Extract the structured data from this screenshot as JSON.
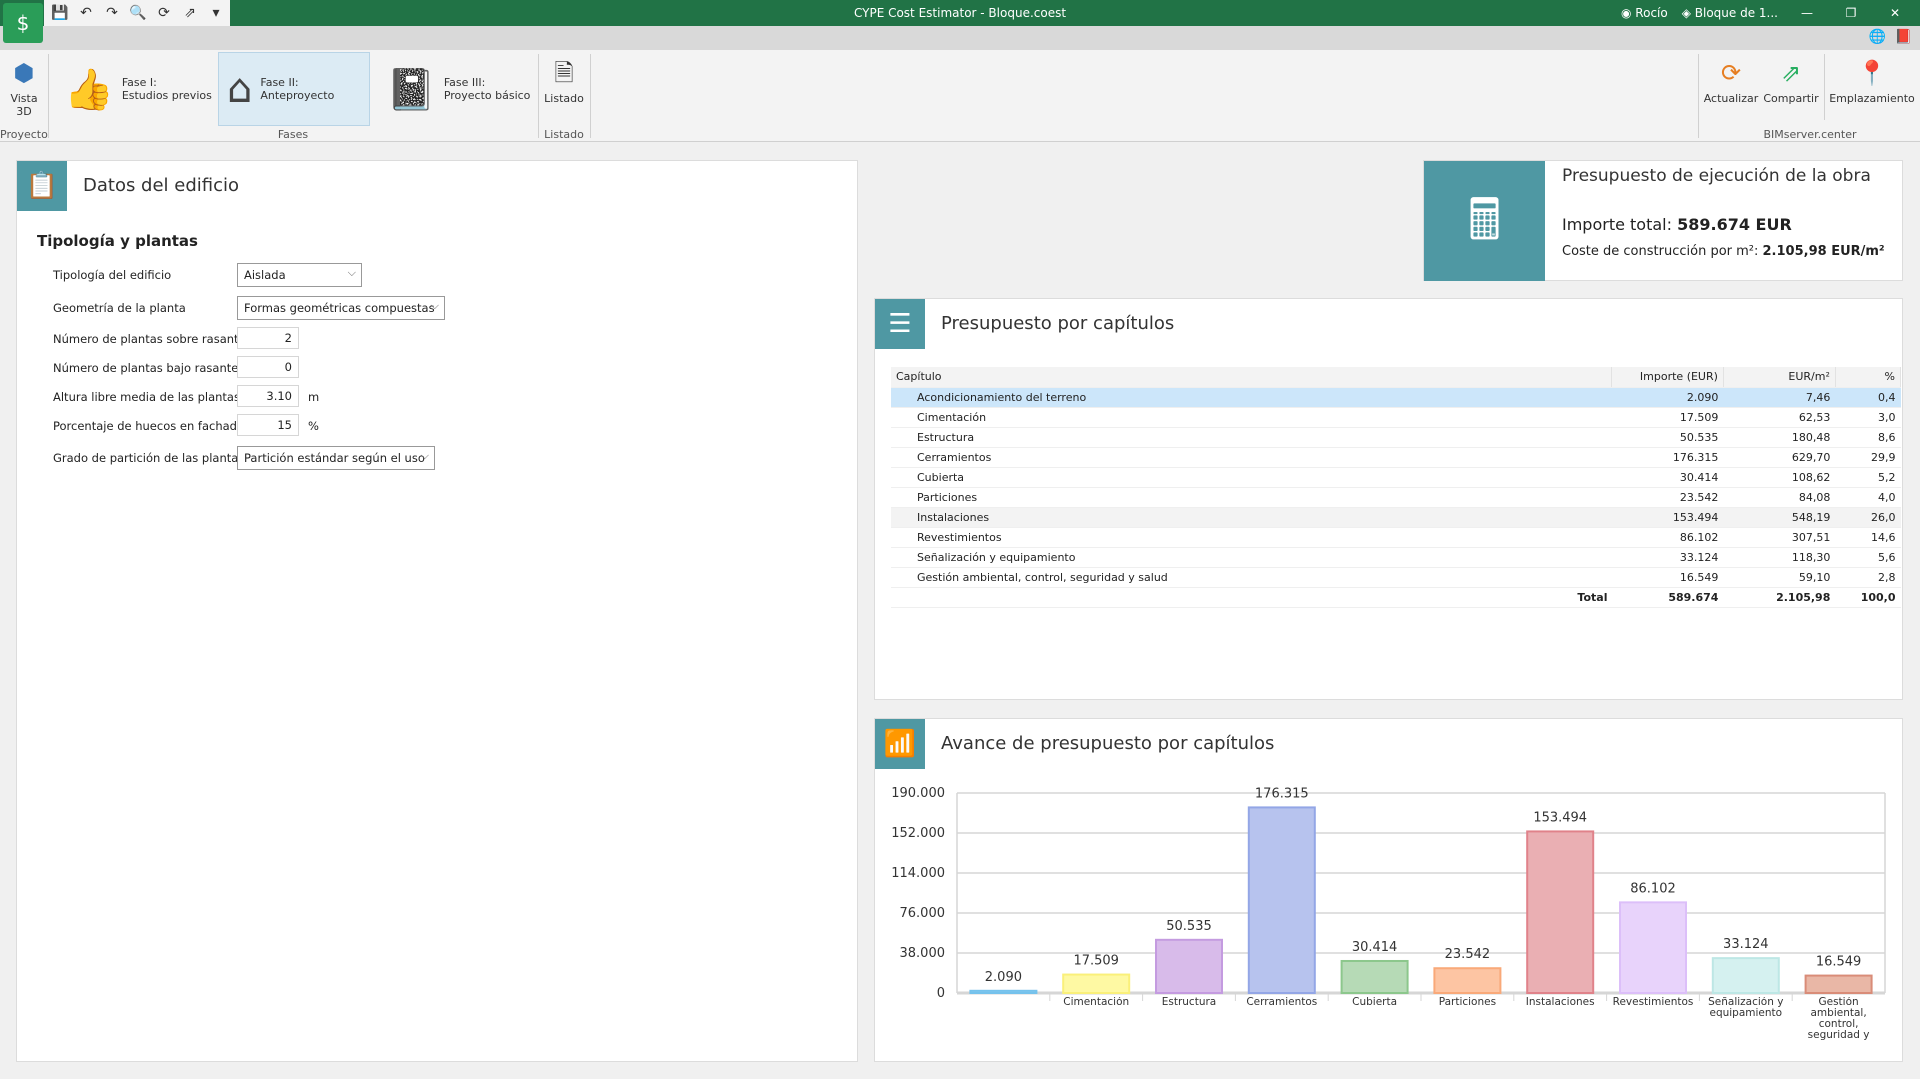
{
  "window": {
    "title": "CYPE Cost Estimator - Bloque.coest",
    "user": "Rocío",
    "project": "Bloque de 1...",
    "minimize": "—",
    "restore": "❐",
    "close": "✕"
  },
  "quick_access": [
    {
      "icon": "save-icon",
      "glyph": "💾"
    },
    {
      "icon": "undo-icon",
      "glyph": "↶"
    },
    {
      "icon": "redo-icon",
      "glyph": "↷"
    },
    {
      "icon": "search-icon",
      "glyph": "🔍"
    },
    {
      "icon": "bimserver-update-icon",
      "glyph": "⟳"
    },
    {
      "icon": "bimserver-share-icon",
      "glyph": "⇗"
    },
    {
      "icon": "customize-icon",
      "glyph": "▾"
    }
  ],
  "ribbon": {
    "vista3d": "Vista\n3D",
    "group_proyecto": "Proyecto",
    "fase1": "Fase I:\nEstudios previos",
    "fase2": "Fase II:\nAnteproyecto",
    "fase3": "Fase III:\nProyecto básico",
    "group_fases": "Fases",
    "listado": "Listado",
    "group_listado": "Listado",
    "actualizar": "Actualizar",
    "compartir": "Compartir",
    "emplazamiento": "Emplazamiento",
    "group_bim": "BIMserver.center"
  },
  "datos": {
    "title": "Datos del edificio",
    "section": "Tipología y plantas",
    "fields": [
      {
        "label": "Tipología del edificio",
        "value": "Aislada"
      },
      {
        "label": "Geometría de la planta",
        "value": "Formas geométricas compuestas"
      },
      {
        "label": "Número de plantas sobre rasante",
        "value": "2"
      },
      {
        "label": "Número de plantas bajo rasante",
        "value": "0"
      },
      {
        "label": "Altura libre media de las plantas",
        "value": "3.10",
        "unit": "m"
      },
      {
        "label": "Porcentaje de huecos en fachadas",
        "value": "15",
        "unit": "%"
      },
      {
        "label": "Grado de partición de las plantas",
        "value": "Partición estándar según el uso"
      }
    ]
  },
  "presupuesto": {
    "title": "Presupuesto de ejecución de la obra",
    "importe_label": "Importe total: ",
    "importe": "589.674 EUR",
    "coste_label": "Coste de construcción por m²: ",
    "coste": "2.105,98 EUR/m²"
  },
  "capitulos": {
    "title": "Presupuesto por capítulos",
    "headers": [
      "Capítulo",
      "Importe (EUR)",
      "EUR/m²",
      "%"
    ],
    "rows": [
      [
        "Acondicionamiento del terreno",
        "2.090",
        "7,46",
        "0,4"
      ],
      [
        "Cimentación",
        "17.509",
        "62,53",
        "3,0"
      ],
      [
        "Estructura",
        "50.535",
        "180,48",
        "8,6"
      ],
      [
        "Cerramientos",
        "176.315",
        "629,70",
        "29,9"
      ],
      [
        "Cubierta",
        "30.414",
        "108,62",
        "5,2"
      ],
      [
        "Particiones",
        "23.542",
        "84,08",
        "4,0"
      ],
      [
        "Instalaciones",
        "153.494",
        "548,19",
        "26,0"
      ],
      [
        "Revestimientos",
        "86.102",
        "307,51",
        "14,6"
      ],
      [
        "Señalización y equipamiento",
        "33.124",
        "118,30",
        "5,6"
      ],
      [
        "Gestión ambiental, control, seguridad y salud",
        "16.549",
        "59,10",
        "2,8"
      ]
    ],
    "total": [
      "Total",
      "589.674",
      "2.105,98",
      "100,0"
    ]
  },
  "avance": {
    "title": "Avance de presupuesto por capítulos"
  },
  "chart_data": {
    "type": "bar",
    "ylim": [
      0,
      190000
    ],
    "grid": true,
    "yticks": [
      "0",
      "38.000",
      "76.000",
      "114.000",
      "152.000",
      "190.000"
    ],
    "categories": [
      "",
      "Cimentación",
      "Estructura",
      "Cerramientos",
      "Cubierta",
      "Particiones",
      "Instalaciones",
      "Revestimientos",
      "Señalización y equipamiento",
      "Gestión ambiental, control, seguridad y"
    ],
    "values": [
      2090,
      17509,
      50535,
      176315,
      30414,
      23542,
      153494,
      86102,
      33124,
      16549
    ],
    "labels": [
      "2.090",
      "17.509",
      "50.535",
      "176.315",
      "30.414",
      "23.542",
      "153.494",
      "86.102",
      "33.124",
      "16.549"
    ],
    "colors": [
      "#8fd0f2",
      "#fef9a3",
      "#d8bbea",
      "#b7c3ee",
      "#b6dab6",
      "#fdc5a3",
      "#eaafb3",
      "#e8d3fb",
      "#d5f1f0",
      "#e9b7a6"
    ],
    "borders": [
      "#75c2ec",
      "#faf07a",
      "#c49be0",
      "#93a6e6",
      "#8cc78c",
      "#f9a979",
      "#e0828a",
      "#dcbff9",
      "#bde7e5",
      "#d98c78"
    ]
  },
  "colors": {
    "titlebar": "#217346",
    "accent": "#4f98a3",
    "selection": "#cce6fa"
  }
}
